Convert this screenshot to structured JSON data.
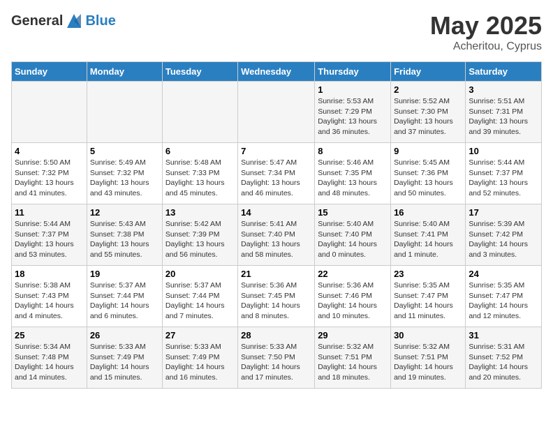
{
  "header": {
    "logo_general": "General",
    "logo_blue": "Blue",
    "title": "May 2025",
    "location": "Acheritou, Cyprus"
  },
  "days_of_week": [
    "Sunday",
    "Monday",
    "Tuesday",
    "Wednesday",
    "Thursday",
    "Friday",
    "Saturday"
  ],
  "weeks": [
    [
      {
        "day": "",
        "info": ""
      },
      {
        "day": "",
        "info": ""
      },
      {
        "day": "",
        "info": ""
      },
      {
        "day": "",
        "info": ""
      },
      {
        "day": "1",
        "info": "Sunrise: 5:53 AM\nSunset: 7:29 PM\nDaylight: 13 hours and 36 minutes."
      },
      {
        "day": "2",
        "info": "Sunrise: 5:52 AM\nSunset: 7:30 PM\nDaylight: 13 hours and 37 minutes."
      },
      {
        "day": "3",
        "info": "Sunrise: 5:51 AM\nSunset: 7:31 PM\nDaylight: 13 hours and 39 minutes."
      }
    ],
    [
      {
        "day": "4",
        "info": "Sunrise: 5:50 AM\nSunset: 7:32 PM\nDaylight: 13 hours and 41 minutes."
      },
      {
        "day": "5",
        "info": "Sunrise: 5:49 AM\nSunset: 7:32 PM\nDaylight: 13 hours and 43 minutes."
      },
      {
        "day": "6",
        "info": "Sunrise: 5:48 AM\nSunset: 7:33 PM\nDaylight: 13 hours and 45 minutes."
      },
      {
        "day": "7",
        "info": "Sunrise: 5:47 AM\nSunset: 7:34 PM\nDaylight: 13 hours and 46 minutes."
      },
      {
        "day": "8",
        "info": "Sunrise: 5:46 AM\nSunset: 7:35 PM\nDaylight: 13 hours and 48 minutes."
      },
      {
        "day": "9",
        "info": "Sunrise: 5:45 AM\nSunset: 7:36 PM\nDaylight: 13 hours and 50 minutes."
      },
      {
        "day": "10",
        "info": "Sunrise: 5:44 AM\nSunset: 7:37 PM\nDaylight: 13 hours and 52 minutes."
      }
    ],
    [
      {
        "day": "11",
        "info": "Sunrise: 5:44 AM\nSunset: 7:37 PM\nDaylight: 13 hours and 53 minutes."
      },
      {
        "day": "12",
        "info": "Sunrise: 5:43 AM\nSunset: 7:38 PM\nDaylight: 13 hours and 55 minutes."
      },
      {
        "day": "13",
        "info": "Sunrise: 5:42 AM\nSunset: 7:39 PM\nDaylight: 13 hours and 56 minutes."
      },
      {
        "day": "14",
        "info": "Sunrise: 5:41 AM\nSunset: 7:40 PM\nDaylight: 13 hours and 58 minutes."
      },
      {
        "day": "15",
        "info": "Sunrise: 5:40 AM\nSunset: 7:40 PM\nDaylight: 14 hours and 0 minutes."
      },
      {
        "day": "16",
        "info": "Sunrise: 5:40 AM\nSunset: 7:41 PM\nDaylight: 14 hours and 1 minute."
      },
      {
        "day": "17",
        "info": "Sunrise: 5:39 AM\nSunset: 7:42 PM\nDaylight: 14 hours and 3 minutes."
      }
    ],
    [
      {
        "day": "18",
        "info": "Sunrise: 5:38 AM\nSunset: 7:43 PM\nDaylight: 14 hours and 4 minutes."
      },
      {
        "day": "19",
        "info": "Sunrise: 5:37 AM\nSunset: 7:44 PM\nDaylight: 14 hours and 6 minutes."
      },
      {
        "day": "20",
        "info": "Sunrise: 5:37 AM\nSunset: 7:44 PM\nDaylight: 14 hours and 7 minutes."
      },
      {
        "day": "21",
        "info": "Sunrise: 5:36 AM\nSunset: 7:45 PM\nDaylight: 14 hours and 8 minutes."
      },
      {
        "day": "22",
        "info": "Sunrise: 5:36 AM\nSunset: 7:46 PM\nDaylight: 14 hours and 10 minutes."
      },
      {
        "day": "23",
        "info": "Sunrise: 5:35 AM\nSunset: 7:47 PM\nDaylight: 14 hours and 11 minutes."
      },
      {
        "day": "24",
        "info": "Sunrise: 5:35 AM\nSunset: 7:47 PM\nDaylight: 14 hours and 12 minutes."
      }
    ],
    [
      {
        "day": "25",
        "info": "Sunrise: 5:34 AM\nSunset: 7:48 PM\nDaylight: 14 hours and 14 minutes."
      },
      {
        "day": "26",
        "info": "Sunrise: 5:33 AM\nSunset: 7:49 PM\nDaylight: 14 hours and 15 minutes."
      },
      {
        "day": "27",
        "info": "Sunrise: 5:33 AM\nSunset: 7:49 PM\nDaylight: 14 hours and 16 minutes."
      },
      {
        "day": "28",
        "info": "Sunrise: 5:33 AM\nSunset: 7:50 PM\nDaylight: 14 hours and 17 minutes."
      },
      {
        "day": "29",
        "info": "Sunrise: 5:32 AM\nSunset: 7:51 PM\nDaylight: 14 hours and 18 minutes."
      },
      {
        "day": "30",
        "info": "Sunrise: 5:32 AM\nSunset: 7:51 PM\nDaylight: 14 hours and 19 minutes."
      },
      {
        "day": "31",
        "info": "Sunrise: 5:31 AM\nSunset: 7:52 PM\nDaylight: 14 hours and 20 minutes."
      }
    ]
  ]
}
